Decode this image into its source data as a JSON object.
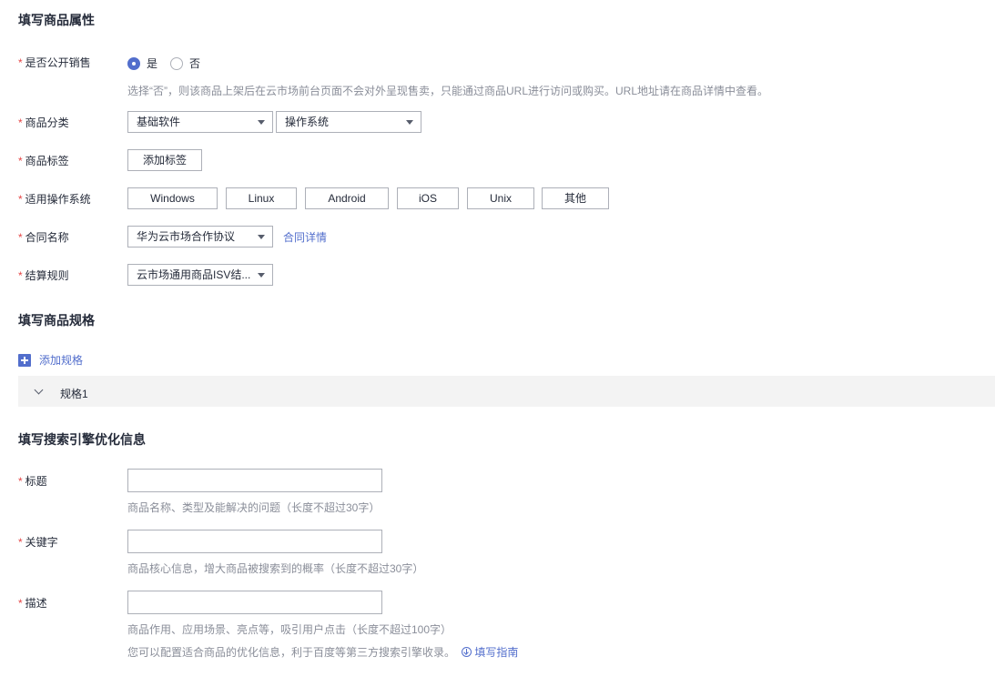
{
  "sections": {
    "attributes_title": "填写商品属性",
    "spec_title": "填写商品规格",
    "seo_title": "填写搜索引擎优化信息"
  },
  "required_mark": "*",
  "public_sale": {
    "label": "是否公开销售",
    "options": [
      "是",
      "否"
    ],
    "selected": "是",
    "hint": "选择“否”，则该商品上架后在云市场前台页面不会对外呈现售卖，只能通过商品URL进行访问或购买。URL地址请在商品详情中查看。"
  },
  "category": {
    "label": "商品分类",
    "primary_value": "基础软件",
    "secondary_value": "操作系统"
  },
  "tags": {
    "label": "商品标签",
    "add_button": "添加标签"
  },
  "os": {
    "label": "适用操作系统",
    "options": [
      "Windows",
      "Linux",
      "Android",
      "iOS",
      "Unix",
      "其他"
    ]
  },
  "contract": {
    "label": "合同名称",
    "value": "华为云市场合作协议",
    "detail_link": "合同详情"
  },
  "settlement": {
    "label": "结算规则",
    "value": "云市场通用商品ISV结..."
  },
  "spec": {
    "add_label": "添加规格",
    "panel_label": "规格1"
  },
  "seo": {
    "title": {
      "label": "标题",
      "value": "",
      "hint": "商品名称、类型及能解决的问题（长度不超过30字）"
    },
    "keywords": {
      "label": "关键字",
      "value": "",
      "hint": "商品核心信息，增大商品被搜索到的概率（长度不超过30字）"
    },
    "description": {
      "label": "描述",
      "value": "",
      "hint": "商品作用、应用场景、亮点等，吸引用户点击（长度不超过100字）"
    },
    "footer_note": "您可以配置适合商品的优化信息，利于百度等第三方搜索引擎收录。",
    "guide_link": "填写指南"
  },
  "colors": {
    "accent": "#526ecc",
    "required": "#e54545",
    "hint": "#8a8e99",
    "panel_bg": "#f3f3f3"
  },
  "icons": {
    "radio_checked": "radio-checked-icon",
    "radio_unchecked": "radio-unchecked-icon",
    "dropdown": "caret-down-icon",
    "add": "plus-square-icon",
    "collapse": "chevron-down-icon",
    "guide": "download-circle-icon"
  }
}
